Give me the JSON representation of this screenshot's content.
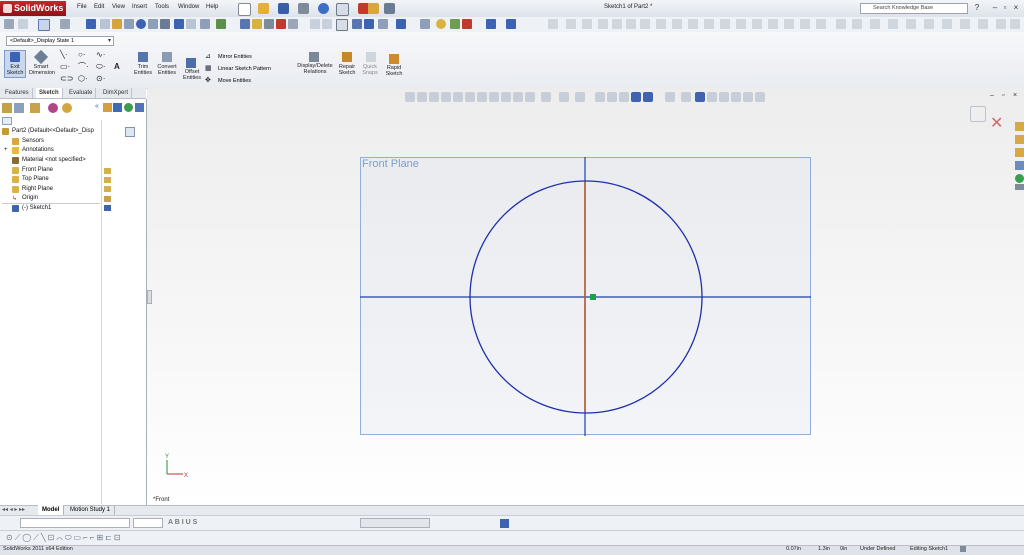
{
  "app": {
    "logo": "SolidWorks",
    "document_title": "Sketch1 of Part2 *"
  },
  "menu": [
    "File",
    "Edit",
    "View",
    "Insert",
    "Tools",
    "Window",
    "Help"
  ],
  "search": {
    "placeholder": "Search Knowledge Base"
  },
  "configuration": "<Default>_Display State 1",
  "commands": {
    "exit_sketch": [
      "Exit",
      "Sketch"
    ],
    "smart_dimension": [
      "Smart",
      "Dimension"
    ],
    "trim_entities": [
      "Trim",
      "Entities"
    ],
    "convert_entities": [
      "Convert",
      "Entities"
    ],
    "offset_entities": [
      "Offset",
      "Entities"
    ],
    "mirror_entities": "Mirror Entities",
    "linear_sketch_pattern": "Linear Sketch Pattern",
    "move_entities": "Move Entities",
    "display_delete_relations": [
      "Display/Delete",
      "Relations"
    ],
    "repair_sketch": [
      "Repair",
      "Sketch"
    ],
    "quick_snaps": [
      "Quick",
      "Snaps"
    ],
    "rapid_sketch": [
      "Rapid",
      "Sketch"
    ]
  },
  "tabs": [
    "Features",
    "Sketch",
    "Evaluate",
    "DimXpert"
  ],
  "active_tab": "Sketch",
  "tree": {
    "root": "Part2  (Default<<Default>_Disp",
    "items": [
      "Sensors",
      "Annotations",
      "Material <not specified>",
      "Front Plane",
      "Top Plane",
      "Right Plane",
      "Origin",
      "(-) Sketch1"
    ]
  },
  "graphics": {
    "plane_label": "Front Plane",
    "view_label": "*Front",
    "colors": {
      "sketch": "#1f2fae",
      "construction_line": "#b5602a",
      "plane_border": "#8fb0d8",
      "origin": "#1aa34a"
    }
  },
  "bottom_tabs": [
    "Model",
    "Motion Study 1"
  ],
  "status": {
    "edition": "SolidWorks 2011 x64 Edition",
    "x": "0.07in",
    "y": "1.3in",
    "z": "0in",
    "state": "Under Defined",
    "editing": "Editing Sketch1"
  }
}
